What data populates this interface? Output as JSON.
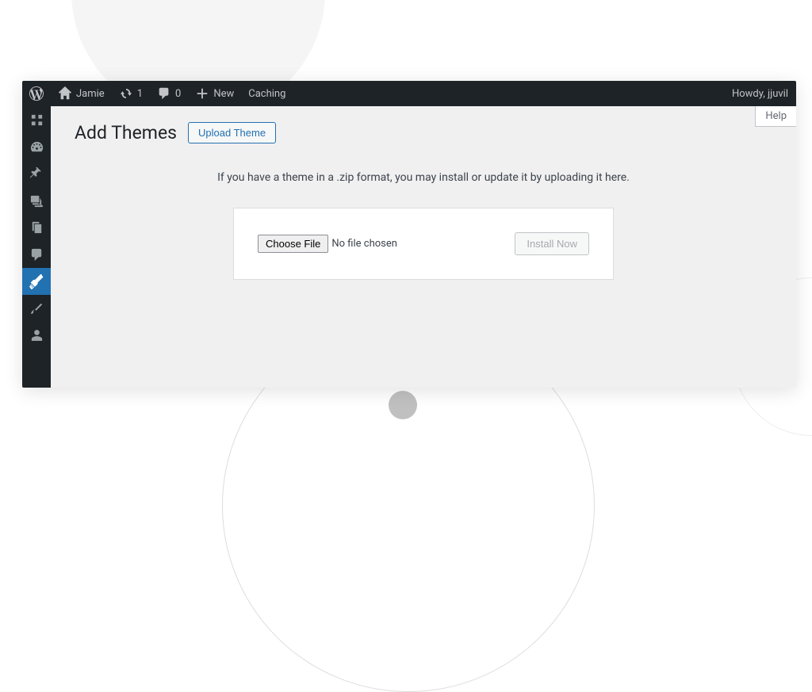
{
  "adminbar": {
    "site_name": "Jamie",
    "updates_count": "1",
    "comments_count": "0",
    "new_label": "New",
    "caching_label": "Caching",
    "howdy": "Howdy, jjuvil"
  },
  "help_tab": "Help",
  "page": {
    "title": "Add Themes",
    "upload_button": "Upload Theme",
    "instruction": "If you have a theme in a .zip format, you may install or update it by uploading it here.",
    "choose_file": "Choose File",
    "file_status": "No file chosen",
    "install_button": "Install Now"
  }
}
